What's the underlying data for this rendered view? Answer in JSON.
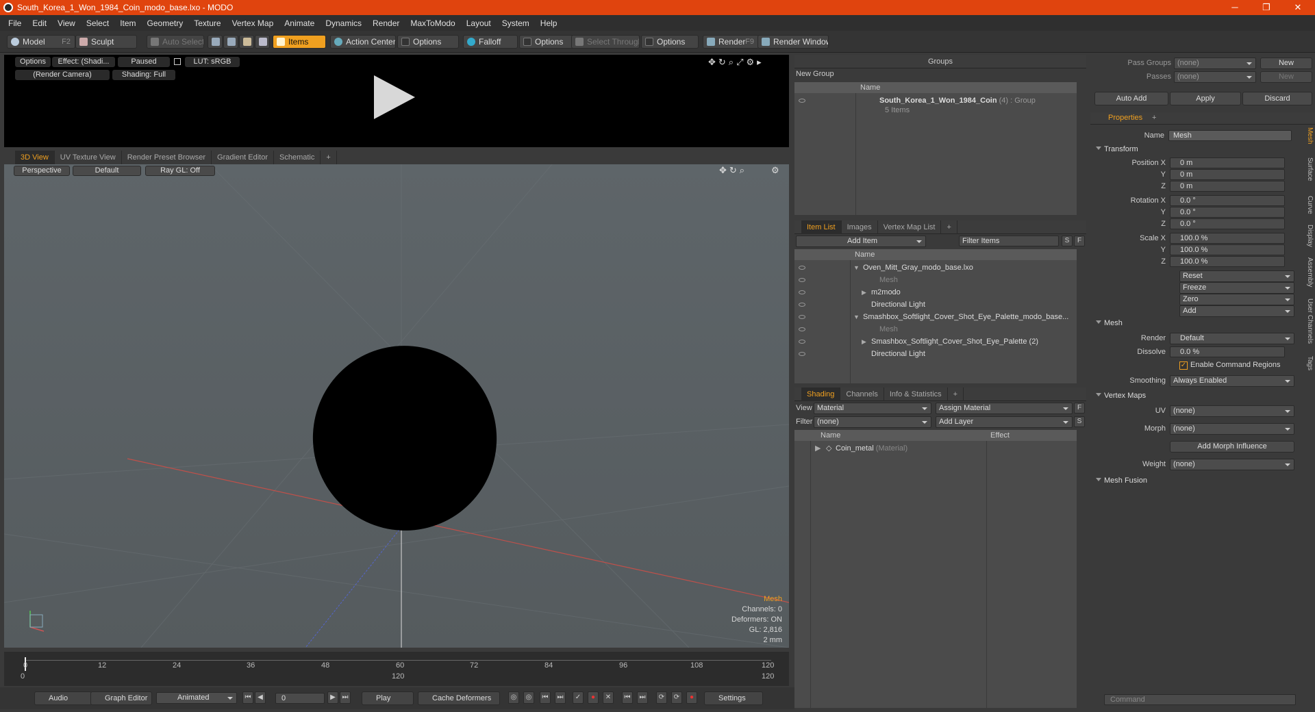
{
  "window": {
    "title": "South_Korea_1_Won_1984_Coin_modo_base.lxo - MODO",
    "minimize": "─",
    "maximize": "❐",
    "close": "✕"
  },
  "menu": [
    "File",
    "Edit",
    "View",
    "Select",
    "Item",
    "Geometry",
    "Texture",
    "Vertex Map",
    "Animate",
    "Dynamics",
    "Render",
    "MaxToModo",
    "Layout",
    "System",
    "Help"
  ],
  "toolbar": {
    "model": "Model",
    "model_key": "F2",
    "sculpt": "Sculpt",
    "auto_select": "Auto Select",
    "items": "Items",
    "action_center": "Action Center",
    "options1": "Options",
    "falloff": "Falloff",
    "options2": "Options",
    "select_through": "Select Through",
    "options3": "Options",
    "render": "Render",
    "render_key": "F9",
    "render_window": "Render Window"
  },
  "preview": {
    "options": "Options",
    "effect": "Effect: (Shadi...",
    "paused": "Paused",
    "lut": "LUT: sRGB",
    "camera": "(Render Camera)",
    "shading": "Shading: Full"
  },
  "viewport": {
    "tabs": [
      "3D View",
      "UV Texture View",
      "Render Preset Browser",
      "Gradient Editor",
      "Schematic",
      "+"
    ],
    "perspective": "Perspective",
    "default": "Default",
    "raygl": "Ray GL: Off",
    "info": {
      "type": "Mesh",
      "channels": "Channels: 0",
      "deformers": "Deformers: ON",
      "gl": "GL: 2,816",
      "scale": "2 mm"
    }
  },
  "timeline": {
    "ticks": [
      "0",
      "12",
      "24",
      "36",
      "48",
      "60",
      "72",
      "84",
      "96",
      "108",
      "120"
    ],
    "sub_ticks": [
      "0",
      "120",
      "120"
    ]
  },
  "bottombar": {
    "audio": "Audio",
    "graph_editor": "Graph Editor",
    "animated": "Animated",
    "frame": "0",
    "play": "Play",
    "cache": "Cache Deformers",
    "settings": "Settings"
  },
  "groups": {
    "title": "Groups",
    "new_group": "New Group",
    "col_name": "Name",
    "item_name": "South_Korea_1_Won_1984_Coin",
    "item_count": "(4)",
    "item_type": ": Group",
    "item_sub": "5 Items"
  },
  "itemlist": {
    "tabs": [
      "Item List",
      "Images",
      "Vertex Map List",
      "+"
    ],
    "add_item": "Add Item",
    "filter": "Filter Items",
    "s": "S",
    "f": "F",
    "col_name": "Name",
    "rows": [
      {
        "label": "Oven_Mitt_Gray_modo_base.lxo",
        "indent": 0,
        "dim": false,
        "arrow": "▼"
      },
      {
        "label": "Mesh",
        "indent": 2,
        "dim": true,
        "arrow": ""
      },
      {
        "label": "m2modo",
        "indent": 1,
        "dim": false,
        "arrow": "▶"
      },
      {
        "label": "Directional Light",
        "indent": 1,
        "dim": false,
        "arrow": ""
      },
      {
        "label": "Smashbox_Softlight_Cover_Shot_Eye_Palette_modo_base...",
        "indent": 0,
        "dim": false,
        "arrow": "▼"
      },
      {
        "label": "Mesh",
        "indent": 2,
        "dim": true,
        "arrow": ""
      },
      {
        "label": "Smashbox_Softlight_Cover_Shot_Eye_Palette (2)",
        "indent": 1,
        "dim": false,
        "arrow": "▶"
      },
      {
        "label": "Directional Light",
        "indent": 1,
        "dim": false,
        "arrow": ""
      }
    ]
  },
  "shading": {
    "tabs": [
      "Shading",
      "Channels",
      "Info & Statistics",
      "+"
    ],
    "view_label": "View",
    "view_value": "Material",
    "assign": "Assign Material",
    "filter_label": "Filter",
    "filter_value": "(none)",
    "add_layer": "Add Layer",
    "f": "F",
    "s": "S",
    "col_name": "Name",
    "col_effect": "Effect",
    "row_name": "Coin_metal",
    "row_type": "(Material)"
  },
  "props": {
    "pass_groups_label": "Pass Groups",
    "pass_groups": "(none)",
    "passes_label": "Passes",
    "passes": "(none)",
    "new1": "New",
    "new2": "New",
    "auto_add": "Auto Add",
    "apply": "Apply",
    "discard": "Discard",
    "tab": "Properties",
    "plus": "+",
    "name_label": "Name",
    "name_value": "Mesh",
    "transform": "Transform",
    "px": "0 m",
    "py": "0 m",
    "pz": "0 m",
    "rx": "0.0 °",
    "ry": "0.0 °",
    "rz": "0.0 °",
    "sx": "100.0 %",
    "sy": "100.0 %",
    "sz": "100.0 %",
    "pos_label": "Position X",
    "rot_label": "Rotation X",
    "scale_label": "Scale X",
    "y": "Y",
    "z": "Z",
    "reset": "Reset",
    "freeze": "Freeze",
    "zero": "Zero",
    "add": "Add",
    "mesh": "Mesh",
    "render_label": "Render",
    "render_value": "Default",
    "dissolve_label": "Dissolve",
    "dissolve_value": "0.0 %",
    "enable_cmd": "Enable Command Regions",
    "smoothing_label": "Smoothing",
    "smoothing_value": "Always Enabled",
    "vertex_maps": "Vertex Maps",
    "uv_label": "UV",
    "uv_value": "(none)",
    "morph_label": "Morph",
    "morph_value": "(none)",
    "add_morph": "Add Morph Influence",
    "weight_label": "Weight",
    "weight_value": "(none)",
    "mesh_fusion": "Mesh Fusion",
    "side_tabs": [
      "Mesh",
      "Surface",
      "Curve",
      "Display",
      "Assembly",
      "User Channels",
      "Tags"
    ],
    "command": "Command"
  }
}
